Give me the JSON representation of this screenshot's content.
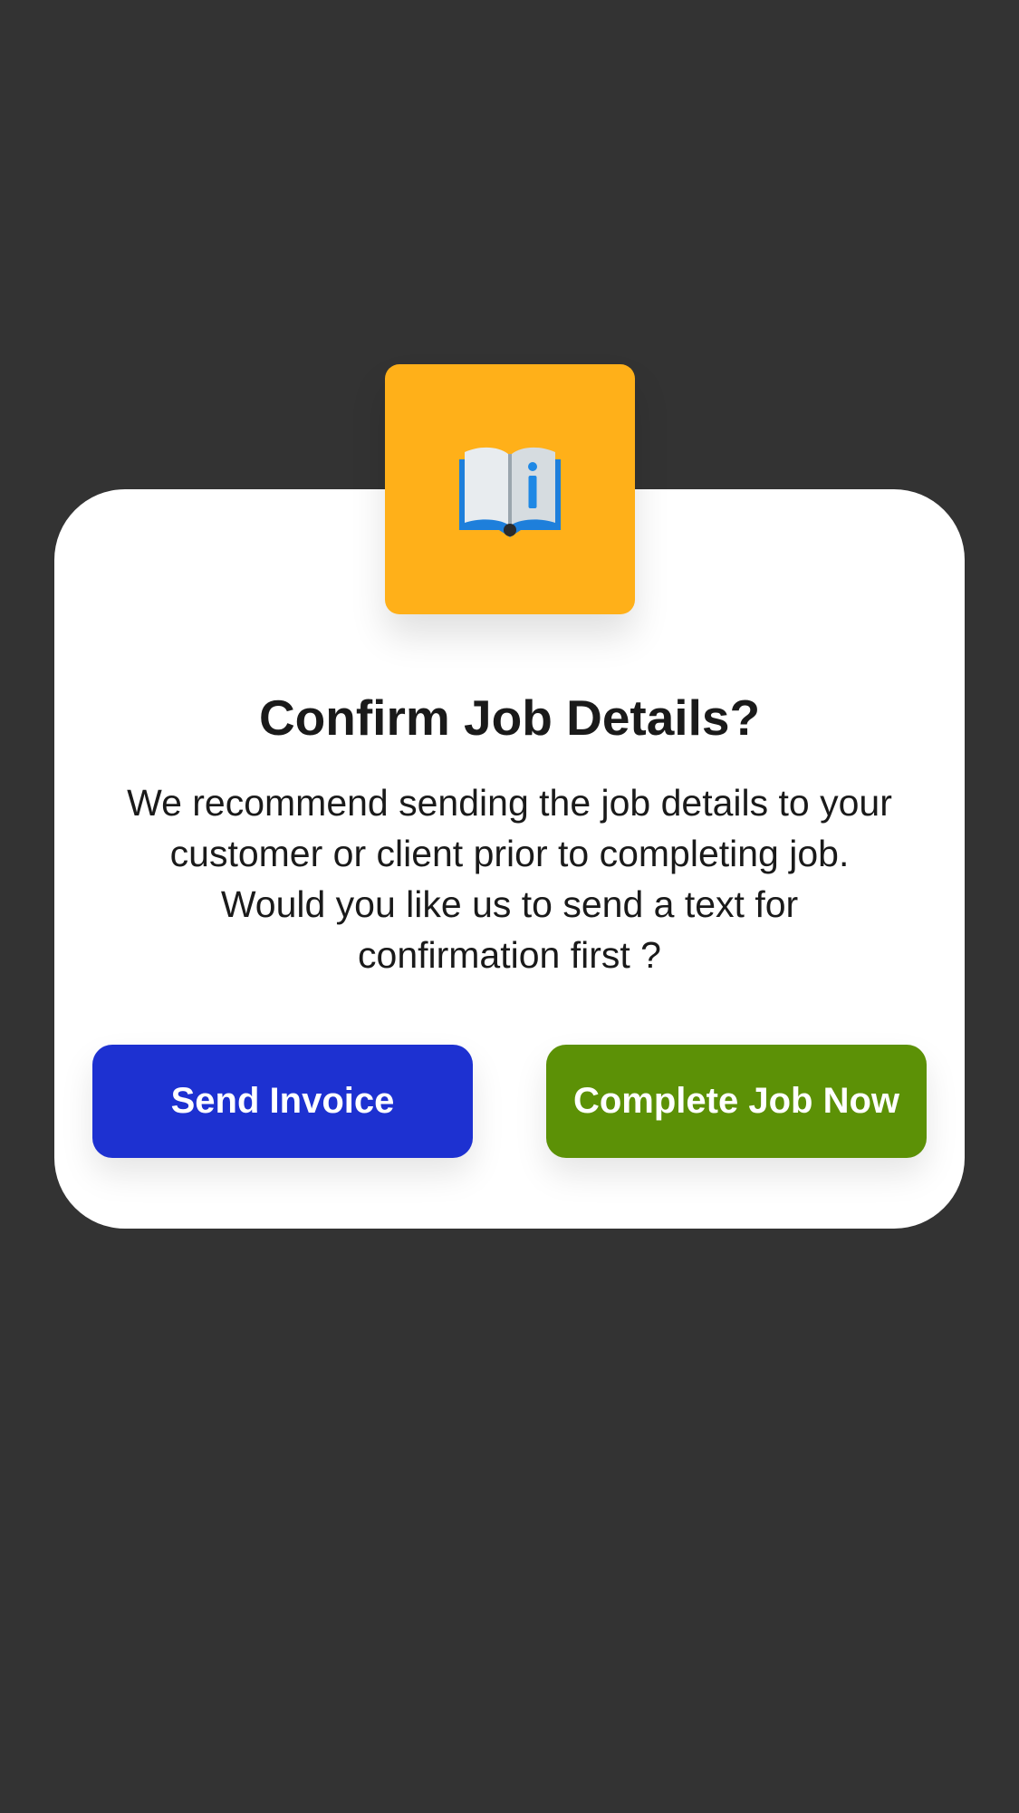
{
  "dialog": {
    "icon": "open-book-info-icon",
    "title": "Confirm Job Details?",
    "message": "We recommend sending the job details to your customer or client prior to completing job. Would you like us to send a text for confirmation first ?",
    "buttons": {
      "send_invoice": "Send Invoice",
      "complete_job": "Complete Job Now"
    }
  },
  "colors": {
    "backdrop": "#333333",
    "card": "#FFFFFF",
    "icon_tile": "#FFB019",
    "send_invoice_button": "#1D31D1",
    "complete_job_button": "#5C9106",
    "text": "#1A1A1A"
  }
}
